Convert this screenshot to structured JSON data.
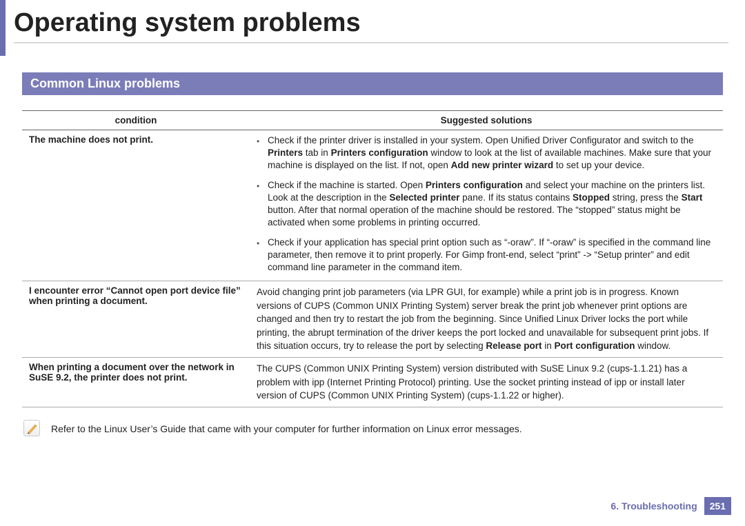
{
  "header": {
    "title": "Operating system problems"
  },
  "section": {
    "title": "Common Linux problems"
  },
  "table": {
    "headers": {
      "condition": "condition",
      "solutions": "Suggested solutions"
    },
    "rows": [
      {
        "condition": "The machine does not print.",
        "bullets": [
          {
            "pre": "Check if the printer driver is installed in your system. Open Unified Driver Configurator and switch to the ",
            "b1": "Printers",
            "mid1": " tab in ",
            "b2": "Printers configuration",
            "mid2": " window to look at the list of available machines. Make sure that your machine is displayed on the list. If not, open ",
            "b3": "Add new printer wizard",
            "post": " to set up your device."
          },
          {
            "pre": "Check if the machine is started. Open ",
            "b1": "Printers configuration",
            "mid1": " and select your machine on the printers list. Look at the description in the ",
            "b2": "Selected printer",
            "mid2": " pane. If its status contains ",
            "b3": "Stopped",
            "mid3": " string, press the ",
            "b4": "Start",
            "post": " button. After that normal operation of the machine should be restored. The “stopped” status might be activated when some problems in printing occurred."
          },
          {
            "pre": "Check if your application has special print option such as “-oraw”. If “-oraw” is specified in the command line parameter, then remove it to print properly. For Gimp front-end, select “print” -> “Setup printer” and edit command line parameter in the command item.",
            "b1": "",
            "mid1": "",
            "b2": "",
            "mid2": "",
            "b3": "",
            "mid3": "",
            "b4": "",
            "post": ""
          }
        ]
      },
      {
        "condition": "I encounter error “Cannot open port device file” when printing a document.",
        "plain_pre": "Avoid changing print job parameters (via LPR GUI, for example) while a print job is in progress. Known versions of CUPS (Common UNIX Printing System) server break the print job whenever print options are changed and then try to restart the job from the beginning. Since Unified Linux Driver locks the port while printing, the abrupt termination of the driver keeps the port locked and unavailable for subsequent print jobs. If this situation occurs, try to release the port by selecting ",
        "plain_b1": "Release port",
        "plain_mid": " in ",
        "plain_b2": "Port configuration",
        "plain_post": " window."
      },
      {
        "condition": "When printing a document over the network in SuSE 9.2, the printer does not print.",
        "plain": "The CUPS (Common UNIX Printing System) version distributed with SuSE Linux 9.2 (cups-1.1.21) has a problem with ipp (Internet Printing Protocol) printing. Use the socket printing instead of ipp or install later version of CUPS (Common UNIX Printing System) (cups-1.1.22 or higher)."
      }
    ]
  },
  "note": {
    "text": "Refer to the Linux User’s Guide that came with your computer for further information on Linux error messages."
  },
  "footer": {
    "chapter": "6.  Troubleshooting",
    "page": "251"
  }
}
